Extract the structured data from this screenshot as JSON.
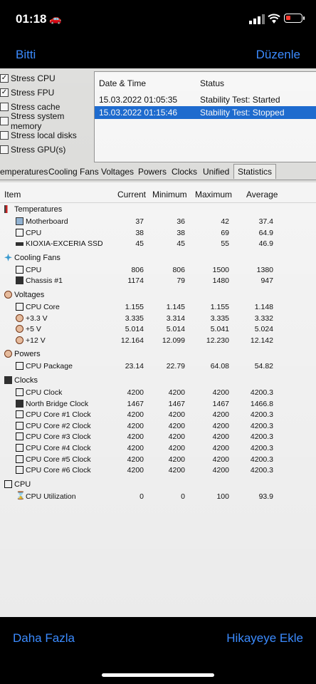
{
  "status_bar": {
    "time": "01:18",
    "car_icon": "car-icon",
    "signal_icon": "signal-icon",
    "wifi_icon": "wifi-icon",
    "battery_icon": "battery-icon",
    "battery_color": "#ff3b30"
  },
  "nav": {
    "done": "Bitti",
    "edit": "Düzenle",
    "accent": "#3b8bff"
  },
  "stress": [
    {
      "label": "Stress CPU",
      "checked": true
    },
    {
      "label": "Stress FPU",
      "checked": true
    },
    {
      "label": "Stress cache",
      "checked": false
    },
    {
      "label": "Stress system memory",
      "checked": false
    },
    {
      "label": "Stress local disks",
      "checked": false
    },
    {
      "label": "Stress GPU(s)",
      "checked": false
    }
  ],
  "log": {
    "headers": [
      "Date & Time",
      "Status"
    ],
    "rows": [
      {
        "time": "15.03.2022 01:05:35",
        "status": "Stability Test: Started",
        "selected": false
      },
      {
        "time": "15.03.2022 01:15:46",
        "status": "Stability Test: Stopped",
        "selected": true
      }
    ]
  },
  "tabs": [
    "emperatures",
    "Cooling Fans",
    "Voltages",
    "Powers",
    "Clocks",
    "Unified",
    "Statistics"
  ],
  "active_tab": "Statistics",
  "grid": {
    "headers": {
      "item": "Item",
      "current": "Current",
      "minimum": "Minimum",
      "maximum": "Maximum",
      "average": "Average"
    },
    "rows": [
      {
        "label": "Temperatures",
        "level": 0,
        "icon": "thermometer-icon"
      },
      {
        "label": "Motherboard",
        "level": 1,
        "icon": "motherboard-icon",
        "cur": "37",
        "min": "36",
        "max": "42",
        "avg": "37.4"
      },
      {
        "label": "CPU",
        "level": 1,
        "icon": "cpu-icon",
        "cur": "38",
        "min": "38",
        "max": "69",
        "avg": "64.9"
      },
      {
        "label": "KIOXIA-EXCERIA SSD",
        "level": 1,
        "icon": "ssd-icon",
        "cur": "45",
        "min": "45",
        "max": "55",
        "avg": "46.9"
      },
      {
        "label": "Cooling Fans",
        "level": 0,
        "icon": "fan-icon"
      },
      {
        "label": "CPU",
        "level": 1,
        "icon": "cpu-icon",
        "cur": "806",
        "min": "806",
        "max": "1500",
        "avg": "1380"
      },
      {
        "label": "Chassis #1",
        "level": 1,
        "icon": "chassis-icon",
        "cur": "1174",
        "min": "79",
        "max": "1480",
        "avg": "947"
      },
      {
        "label": "Voltages",
        "level": 0,
        "icon": "voltage-icon"
      },
      {
        "label": "CPU Core",
        "level": 1,
        "icon": "cpu-icon",
        "cur": "1.155",
        "min": "1.145",
        "max": "1.155",
        "avg": "1.148"
      },
      {
        "label": "+3.3 V",
        "level": 1,
        "icon": "voltage-icon",
        "cur": "3.335",
        "min": "3.314",
        "max": "3.335",
        "avg": "3.332"
      },
      {
        "label": "+5 V",
        "level": 1,
        "icon": "voltage-icon",
        "cur": "5.014",
        "min": "5.014",
        "max": "5.041",
        "avg": "5.024"
      },
      {
        "label": "+12 V",
        "level": 1,
        "icon": "voltage-icon",
        "cur": "12.164",
        "min": "12.099",
        "max": "12.230",
        "avg": "12.142"
      },
      {
        "label": "Powers",
        "level": 0,
        "icon": "power-icon"
      },
      {
        "label": "CPU Package",
        "level": 1,
        "icon": "cpu-icon",
        "cur": "23.14",
        "min": "22.79",
        "max": "64.08",
        "avg": "54.82"
      },
      {
        "label": "Clocks",
        "level": 0,
        "icon": "clock-icon"
      },
      {
        "label": "CPU Clock",
        "level": 1,
        "icon": "cpu-icon",
        "cur": "4200",
        "min": "4200",
        "max": "4200",
        "avg": "4200.3"
      },
      {
        "label": "North Bridge Clock",
        "level": 1,
        "icon": "chip-icon",
        "cur": "1467",
        "min": "1467",
        "max": "1467",
        "avg": "1466.8"
      },
      {
        "label": "CPU Core #1 Clock",
        "level": 1,
        "icon": "cpu-icon",
        "cur": "4200",
        "min": "4200",
        "max": "4200",
        "avg": "4200.3"
      },
      {
        "label": "CPU Core #2 Clock",
        "level": 1,
        "icon": "cpu-icon",
        "cur": "4200",
        "min": "4200",
        "max": "4200",
        "avg": "4200.3"
      },
      {
        "label": "CPU Core #3 Clock",
        "level": 1,
        "icon": "cpu-icon",
        "cur": "4200",
        "min": "4200",
        "max": "4200",
        "avg": "4200.3"
      },
      {
        "label": "CPU Core #4 Clock",
        "level": 1,
        "icon": "cpu-icon",
        "cur": "4200",
        "min": "4200",
        "max": "4200",
        "avg": "4200.3"
      },
      {
        "label": "CPU Core #5 Clock",
        "level": 1,
        "icon": "cpu-icon",
        "cur": "4200",
        "min": "4200",
        "max": "4200",
        "avg": "4200.3"
      },
      {
        "label": "CPU Core #6 Clock",
        "level": 1,
        "icon": "cpu-icon",
        "cur": "4200",
        "min": "4200",
        "max": "4200",
        "avg": "4200.3"
      },
      {
        "label": "CPU",
        "level": 0,
        "icon": "cpu-icon"
      },
      {
        "label": "CPU Utilization",
        "level": 1,
        "icon": "hourglass-icon",
        "cur": "0",
        "min": "0",
        "max": "100",
        "avg": "93.9"
      }
    ]
  },
  "bottom": {
    "more": "Daha Fazla",
    "add_story": "Hikayeye Ekle"
  }
}
